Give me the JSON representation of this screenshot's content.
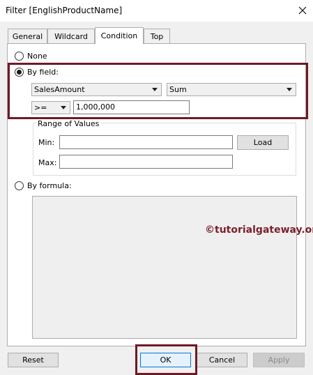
{
  "window": {
    "title": "Filter [EnglishProductName]"
  },
  "tabs": [
    {
      "label": "General"
    },
    {
      "label": "Wildcard"
    },
    {
      "label": "Condition"
    },
    {
      "label": "Top"
    }
  ],
  "condition": {
    "none_label": "None",
    "by_field_label": "By field:",
    "field_select_value": "SalesAmount",
    "aggregation_select_value": "Sum",
    "operator_select_value": ">=",
    "value_input": "1,000,000",
    "range": {
      "group_label": "Range of Values",
      "min_label": "Min:",
      "max_label": "Max:",
      "min_value": "",
      "max_value": "",
      "load_label": "Load"
    },
    "by_formula_label": "By formula:",
    "watermark": "©tutorialgateway.org"
  },
  "footer": {
    "reset_label": "Reset",
    "ok_label": "OK",
    "cancel_label": "Cancel",
    "apply_label": "Apply"
  },
  "colors": {
    "highlight": "#6e1a24",
    "watermark": "#7a1f2b",
    "dialog_bg": "#f0f0f0"
  }
}
